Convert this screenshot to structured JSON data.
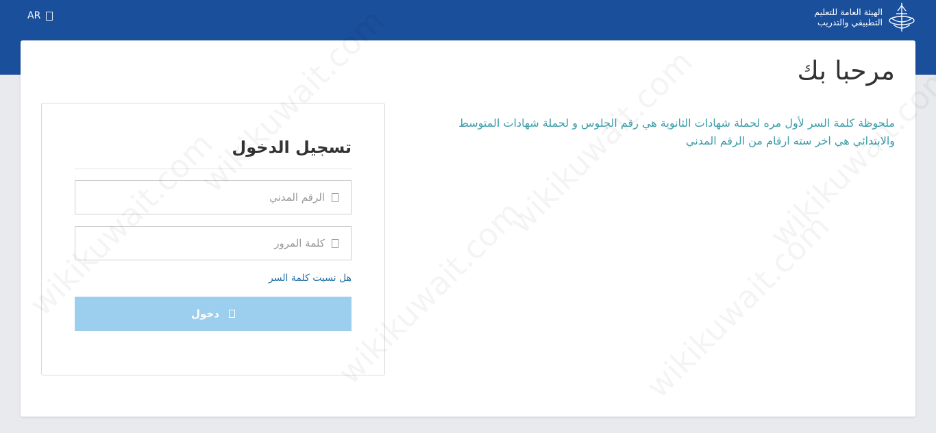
{
  "header": {
    "lang_label": "AR",
    "org_name_line1": "الهيئة العامة للتعليم",
    "org_name_line2": "التطبيقي والتدريب",
    "bg_color": "#1a4f9c"
  },
  "page": {
    "welcome_title": "مرحبا بك",
    "note": "ملحوظة كلمة السر لأول مره لحملة شهادات الثانوية هي رقم الجلوس و لحملة شهادات المتوسط والابتدائي هي اخر سته ارقام من الرقم المدني"
  },
  "login": {
    "title": "تسجيل الدخول",
    "civil_id_placeholder": "الرقم المدني",
    "civil_id_value": "",
    "password_placeholder": "كلمة المرور",
    "password_value": "",
    "forgot_label": "هل نسيت كلمة السر",
    "submit_label": "دخول",
    "submit_color": "#9ccfee"
  },
  "icons": {
    "lang": "globe-icon",
    "civil_id": "user-icon",
    "password": "lock-icon",
    "submit": "sign-in-icon"
  },
  "watermark_text": "wikikuwait.com"
}
